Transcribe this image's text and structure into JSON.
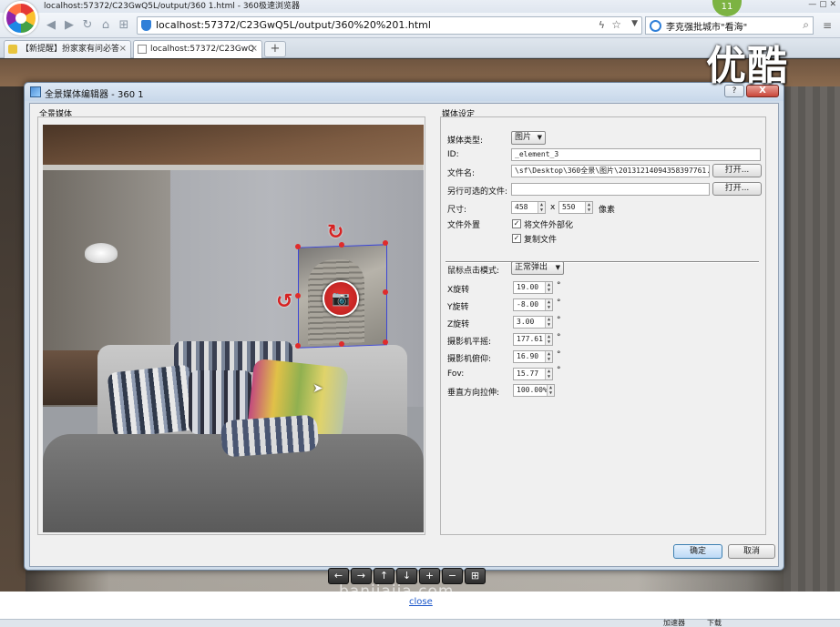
{
  "browser": {
    "window_title": "localhost:57372/C23GwQ5L/output/360  1.html - 360极速浏览器",
    "url": "localhost:57372/C23GwQ5L/output/360%20%201.html",
    "search_text": "李克强批城市\"看海\"",
    "tabs": [
      {
        "label": "【新提醒】扮家家有问必答",
        "close": "×"
      },
      {
        "label": "localhost:57372/C23GwQ",
        "close": "×"
      }
    ],
    "new_tab": "+",
    "status_badge": "11",
    "status_accel": "加速器",
    "status_download": "下载"
  },
  "overlay_logo": "优酷",
  "page": {
    "watermark": "banjiajia.com",
    "close_link": "close",
    "nav_buttons": [
      "←",
      "→",
      "↑",
      "↓",
      "+",
      "−",
      "⊞"
    ]
  },
  "dialog": {
    "title": "全景媒体编辑器 - 360  1",
    "help": "?",
    "close": "X",
    "left_group": "全景媒体",
    "right_group": "媒体设定",
    "fields": {
      "media_type_label": "媒体类型:",
      "media_type_value": "图片",
      "id_label": "ID:",
      "id_value": "_element_3",
      "filename_label": "文件名:",
      "filename_value": "\\sf\\Desktop\\360全景\\图片\\20131214094358397761.jpg",
      "open_label": "打开...",
      "alt_file_label": "另行可选的文件:",
      "alt_file_value": "",
      "open2_label": "打开...",
      "size_label": "尺寸:",
      "width": "458",
      "x_sep": "x",
      "height": "550",
      "size_unit": "像素",
      "file_ext_label": "文件外置",
      "ext_chk1_label": "将文件外部化",
      "ext_chk2_label": "复制文件",
      "mouse_mode_label": "鼠标点击模式:",
      "mouse_mode_value": "正常弹出",
      "x_rot_label": "X旋转",
      "x_rot_value": "19.00",
      "y_rot_label": "Y旋转",
      "y_rot_value": "-8.00",
      "z_rot_label": "Z旋转",
      "z_rot_value": "3.00",
      "cam_pan_label": "摄影机平摇:",
      "cam_pan_value": "177.61",
      "cam_tilt_label": "摄影机俯仰:",
      "cam_tilt_value": "16.90",
      "fov_label": "Fov:",
      "fov_value": "15.77",
      "stretch_label": "垂直方向拉伸:",
      "stretch_value": "100.00%",
      "degree": "°"
    },
    "ok": "确定",
    "cancel": "取消"
  },
  "icons": {
    "camera": "camera-icon",
    "rotate": "rotate-icon"
  },
  "colors": {
    "handle": "#e02b2b",
    "media_border": "#3c46d6",
    "camera_button": "#d32f2f"
  }
}
